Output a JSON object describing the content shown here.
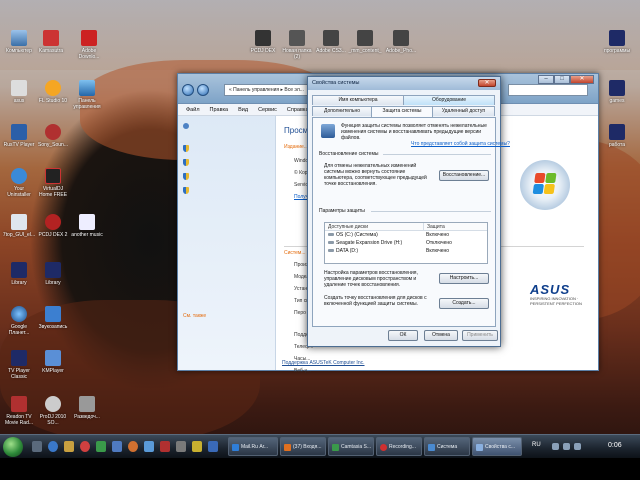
{
  "desktop": {
    "icons_left": [
      {
        "label": "Компьютер"
      },
      {
        "label": "Kamasutra"
      },
      {
        "label": "asus"
      },
      {
        "label": "FL Studio 10"
      },
      {
        "label": "Панель управления"
      },
      {
        "label": "RusTV Player"
      },
      {
        "label": "Sony_Soun..."
      },
      {
        "label": "Your Uninstaller"
      },
      {
        "label": "VirtualDJ Home FREE"
      },
      {
        "label": "7top_GUI_el..."
      },
      {
        "label": "PCDJ DEX 2"
      },
      {
        "label": "another music"
      },
      {
        "label": "Library"
      },
      {
        "label": "Library"
      },
      {
        "label": "Google Планет..."
      },
      {
        "label": "Звукозапись"
      },
      {
        "label": "TV Player Classic"
      },
      {
        "label": "KMPlayer"
      },
      {
        "label": "Readon TV Movie Rad..."
      },
      {
        "label": "ProDJ 2010 SO..."
      },
      {
        "label": "Разведоч..."
      }
    ],
    "icons_top": [
      {
        "label": "Adobe Downlo..."
      },
      {
        "label": "PCDJ DEX"
      },
      {
        "label": "Новая папка (2)"
      },
      {
        "label": "Adobe CS3..."
      },
      {
        "label": "_mm_content_"
      },
      {
        "label": "Adobe_Pho..."
      }
    ],
    "icons_right": [
      {
        "label": "программы"
      },
      {
        "label": "games"
      },
      {
        "label": "работа"
      }
    ]
  },
  "explorer": {
    "address": "« Панель управления ▸ Все эл...",
    "menu": [
      "Файл",
      "Правка",
      "Вид",
      "Сервис",
      "Справка"
    ],
    "main_title": "Просм...",
    "section_edition": "Издание...",
    "edition_lines": [
      "Windo...",
      "© Корп...",
      "Servic..."
    ],
    "edition_link": "Получ...",
    "section_system": "Систем...",
    "system_lines": [
      "Произ...",
      "Модел...",
      "Устан...",
      "Тип си...",
      "Перо и..."
    ],
    "system_lines2": [
      "Подде...",
      "Телеф...",
      "Часы...",
      "Веб-у..."
    ],
    "see_also": "См. также",
    "support_link": "Поддержка ASUSTeK Computer Inc.",
    "oem_brand": "ASUS",
    "oem_tagline": "INSPIRING INNOVATION · PERSISTENT PERFECTION"
  },
  "dialog": {
    "title": "Свойства системы",
    "tabs_row1": [
      "Имя компьютера",
      "Оборудование"
    ],
    "tabs_row2": [
      "Дополнительно",
      "Защита системы",
      "Удаленный доступ"
    ],
    "intro": "Функция защиты системы позволяет отменять нежелательные изменения системы и восстанавливать предыдущие версии файлов.",
    "intro_link": "Что представляет собой защита системы?",
    "restore_group": "Восстановление системы",
    "restore_text": "Для отмены нежелательных изменений системы можно вернуть состояние компьютера, соответствующее предыдущей точке восстановления.",
    "restore_button": "Восстановление...",
    "params_group": "Параметры защиты",
    "table_headers": [
      "Доступные диски",
      "Защита"
    ],
    "drives": [
      {
        "name": "OS (C:) (Система)",
        "status": "Включено"
      },
      {
        "name": "Seagate Expansion Drive (H:)",
        "status": "Отключено"
      },
      {
        "name": "DATA (D:)",
        "status": "Включено"
      }
    ],
    "configure_text": "Настройка параметров восстановления, управление дисковым пространством и удаление точек восстановления.",
    "configure_button": "Настроить...",
    "create_text": "Создать точку восстановления для дисков с включенной функцией защиты системы.",
    "create_button": "Создать...",
    "ok": "ОК",
    "cancel": "Отмена",
    "apply": "Применить"
  },
  "taskbar": {
    "buttons": [
      {
        "label": "Mail.Ru Аг..."
      },
      {
        "label": "(37) Входя..."
      },
      {
        "label": "Camtasia S..."
      },
      {
        "label": "Recording..."
      },
      {
        "label": "Система"
      },
      {
        "label": "Свойства с..."
      }
    ],
    "lang": "RU",
    "clock": "0:06"
  },
  "colors": {
    "accent_blue": "#1f4e94",
    "link_orange": "#e46b0b",
    "asus_blue": "#0f3f8c"
  }
}
